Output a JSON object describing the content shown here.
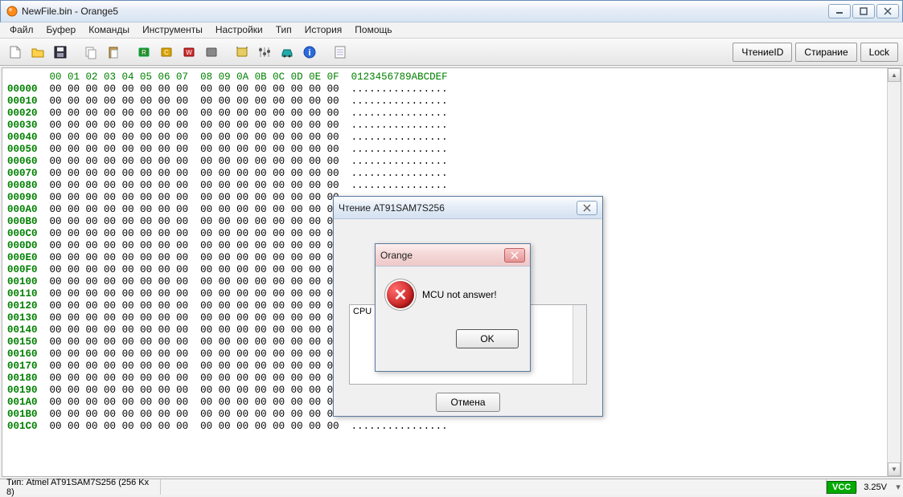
{
  "window": {
    "title": "NewFile.bin - Orange5"
  },
  "menu": [
    "Файл",
    "Буфер",
    "Команды",
    "Инструменты",
    "Настройки",
    "Тип",
    "История",
    "Помощь"
  ],
  "toolbar": {
    "icons": [
      "new-file-icon",
      "open-icon",
      "save-icon",
      "copy-icon",
      "paste-icon",
      "chip-read-icon",
      "chip-compare-icon",
      "chip-write-icon",
      "chip-erase-icon",
      "chip-config-icon",
      "sliders-icon",
      "car-icon",
      "info-icon",
      "doc-icon"
    ],
    "right": {
      "read_id": "ЧтениеID",
      "erase": "Стирание",
      "lock": "Lock"
    }
  },
  "hex": {
    "col_header": [
      "00",
      "01",
      "02",
      "03",
      "04",
      "05",
      "06",
      "07",
      "08",
      "09",
      "0A",
      "0B",
      "0C",
      "0D",
      "0E",
      "0F"
    ],
    "ascii_header": "0123456789ABCDEF",
    "rows": [
      "00000",
      "00010",
      "00020",
      "00030",
      "00040",
      "00050",
      "00060",
      "00070",
      "00080",
      "00090",
      "000A0",
      "000B0",
      "000C0",
      "000D0",
      "000E0",
      "000F0",
      "00100",
      "00110",
      "00120",
      "00130",
      "00140",
      "00150",
      "00160",
      "00170",
      "00180",
      "00190",
      "001A0",
      "001B0",
      "001C0"
    ],
    "byte": "00",
    "ascii_row": "................"
  },
  "dialog_read": {
    "title": "Чтение AT91SAM7S256",
    "log_line": "CPU ID=F",
    "cancel": "Отмена"
  },
  "dialog_error": {
    "title": "Orange",
    "message": "MCU not answer!",
    "ok": "OK"
  },
  "status": {
    "type_label": "Тип: Atmel AT91SAM7S256 (256 Kx 8)",
    "vcc": "VCC",
    "volt": "3.25V"
  },
  "colors": {
    "green": "#008000"
  }
}
